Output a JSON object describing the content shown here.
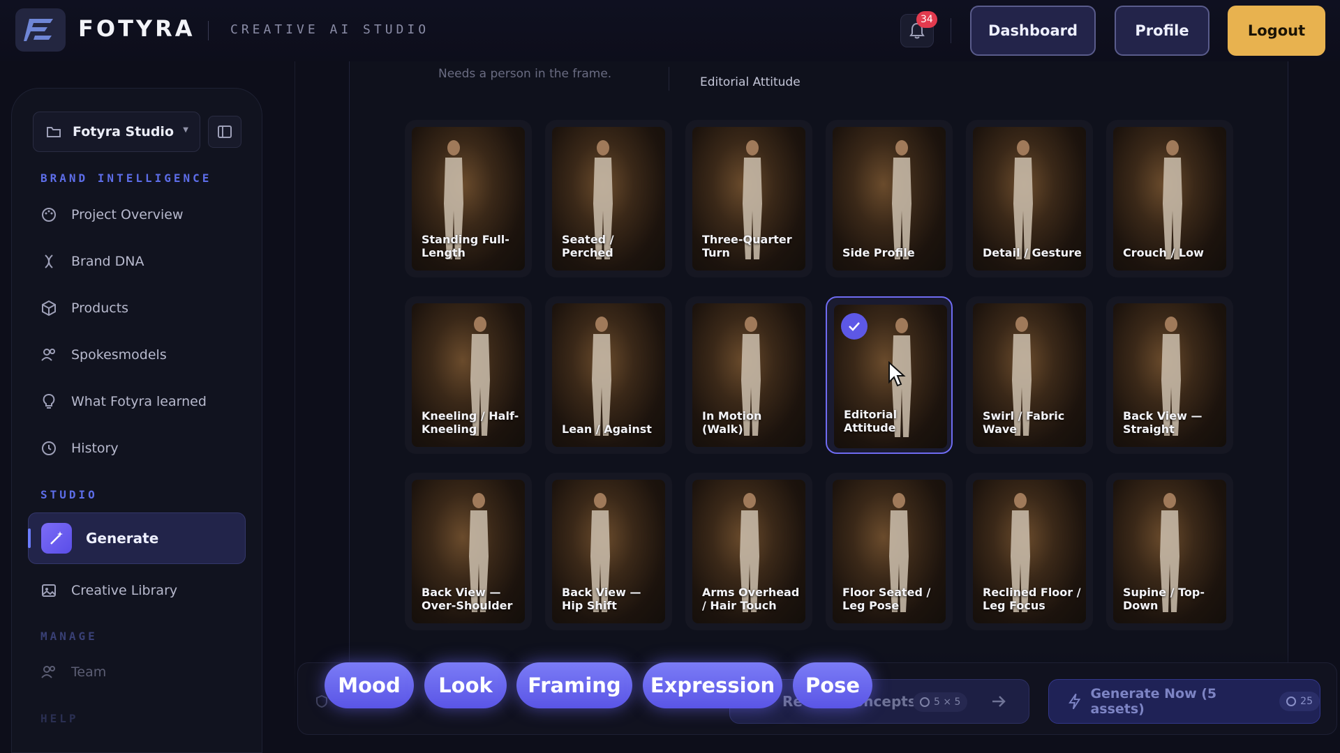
{
  "header": {
    "brand": "FOTYRA",
    "tagline": "CREATIVE AI STUDIO",
    "notification_count": "34",
    "dashboard_label": "Dashboard",
    "profile_label": "Profile",
    "logout_label": "Logout"
  },
  "sidebar": {
    "workspace": "Fotyra Studio",
    "section_brand": "BRAND INTELLIGENCE",
    "brand_items": [
      {
        "label": "Project Overview",
        "icon": "palette-icon"
      },
      {
        "label": "Brand DNA",
        "icon": "dna-icon"
      },
      {
        "label": "Products",
        "icon": "box-icon"
      },
      {
        "label": "Spokesmodels",
        "icon": "users-icon"
      },
      {
        "label": "What Fotyra learned",
        "icon": "lightbulb-icon"
      },
      {
        "label": "History",
        "icon": "clock-icon"
      }
    ],
    "section_studio": "STUDIO",
    "studio_items": [
      {
        "label": "Generate",
        "icon": "magic-wand-icon",
        "active": true
      },
      {
        "label": "Creative Library",
        "icon": "image-icon"
      }
    ],
    "section_manage": "MANAGE",
    "manage_items": [
      {
        "label": "Team",
        "icon": "users-icon"
      }
    ],
    "section_help": "HELP"
  },
  "main": {
    "hint": "Needs a person in the frame.",
    "selected_caption": "Editorial Attitude",
    "poses": [
      {
        "label": "Standing Full-Length",
        "selected": false
      },
      {
        "label": "Seated / Perched",
        "selected": false
      },
      {
        "label": "Three-Quarter Turn",
        "selected": false
      },
      {
        "label": "Side Profile",
        "selected": false
      },
      {
        "label": "Detail / Gesture",
        "selected": false
      },
      {
        "label": "Crouch / Low",
        "selected": false
      },
      {
        "label": "Kneeling / Half-Kneeling",
        "selected": false
      },
      {
        "label": "Lean / Against",
        "selected": false
      },
      {
        "label": "In Motion (Walk)",
        "selected": false
      },
      {
        "label": "Editorial Attitude",
        "selected": true
      },
      {
        "label": "Swirl / Fabric Wave",
        "selected": false
      },
      {
        "label": "Back View — Straight",
        "selected": false
      },
      {
        "label": "Back View — Over-Shoulder",
        "selected": false
      },
      {
        "label": "Back View — Hip Shift",
        "selected": false
      },
      {
        "label": "Arms Overhead / Hair Touch",
        "selected": false
      },
      {
        "label": "Floor Seated / Leg Pose",
        "selected": false
      },
      {
        "label": "Reclined Floor / Leg Focus",
        "selected": false
      },
      {
        "label": "Supine / Top-Down",
        "selected": false
      }
    ]
  },
  "tabs": [
    "Mood",
    "Look",
    "Framing",
    "Expression",
    "Pose"
  ],
  "bottom_bar": {
    "review_label": "Review Concepts",
    "review_count": "5 × 5",
    "generate_label": "Generate Now (5 assets)",
    "generate_cost": "25"
  },
  "colors": {
    "accent": "#6b6cf2",
    "logout": "#e8b24f",
    "section_label": "#5d6de8",
    "badge": "#e23a4e"
  }
}
